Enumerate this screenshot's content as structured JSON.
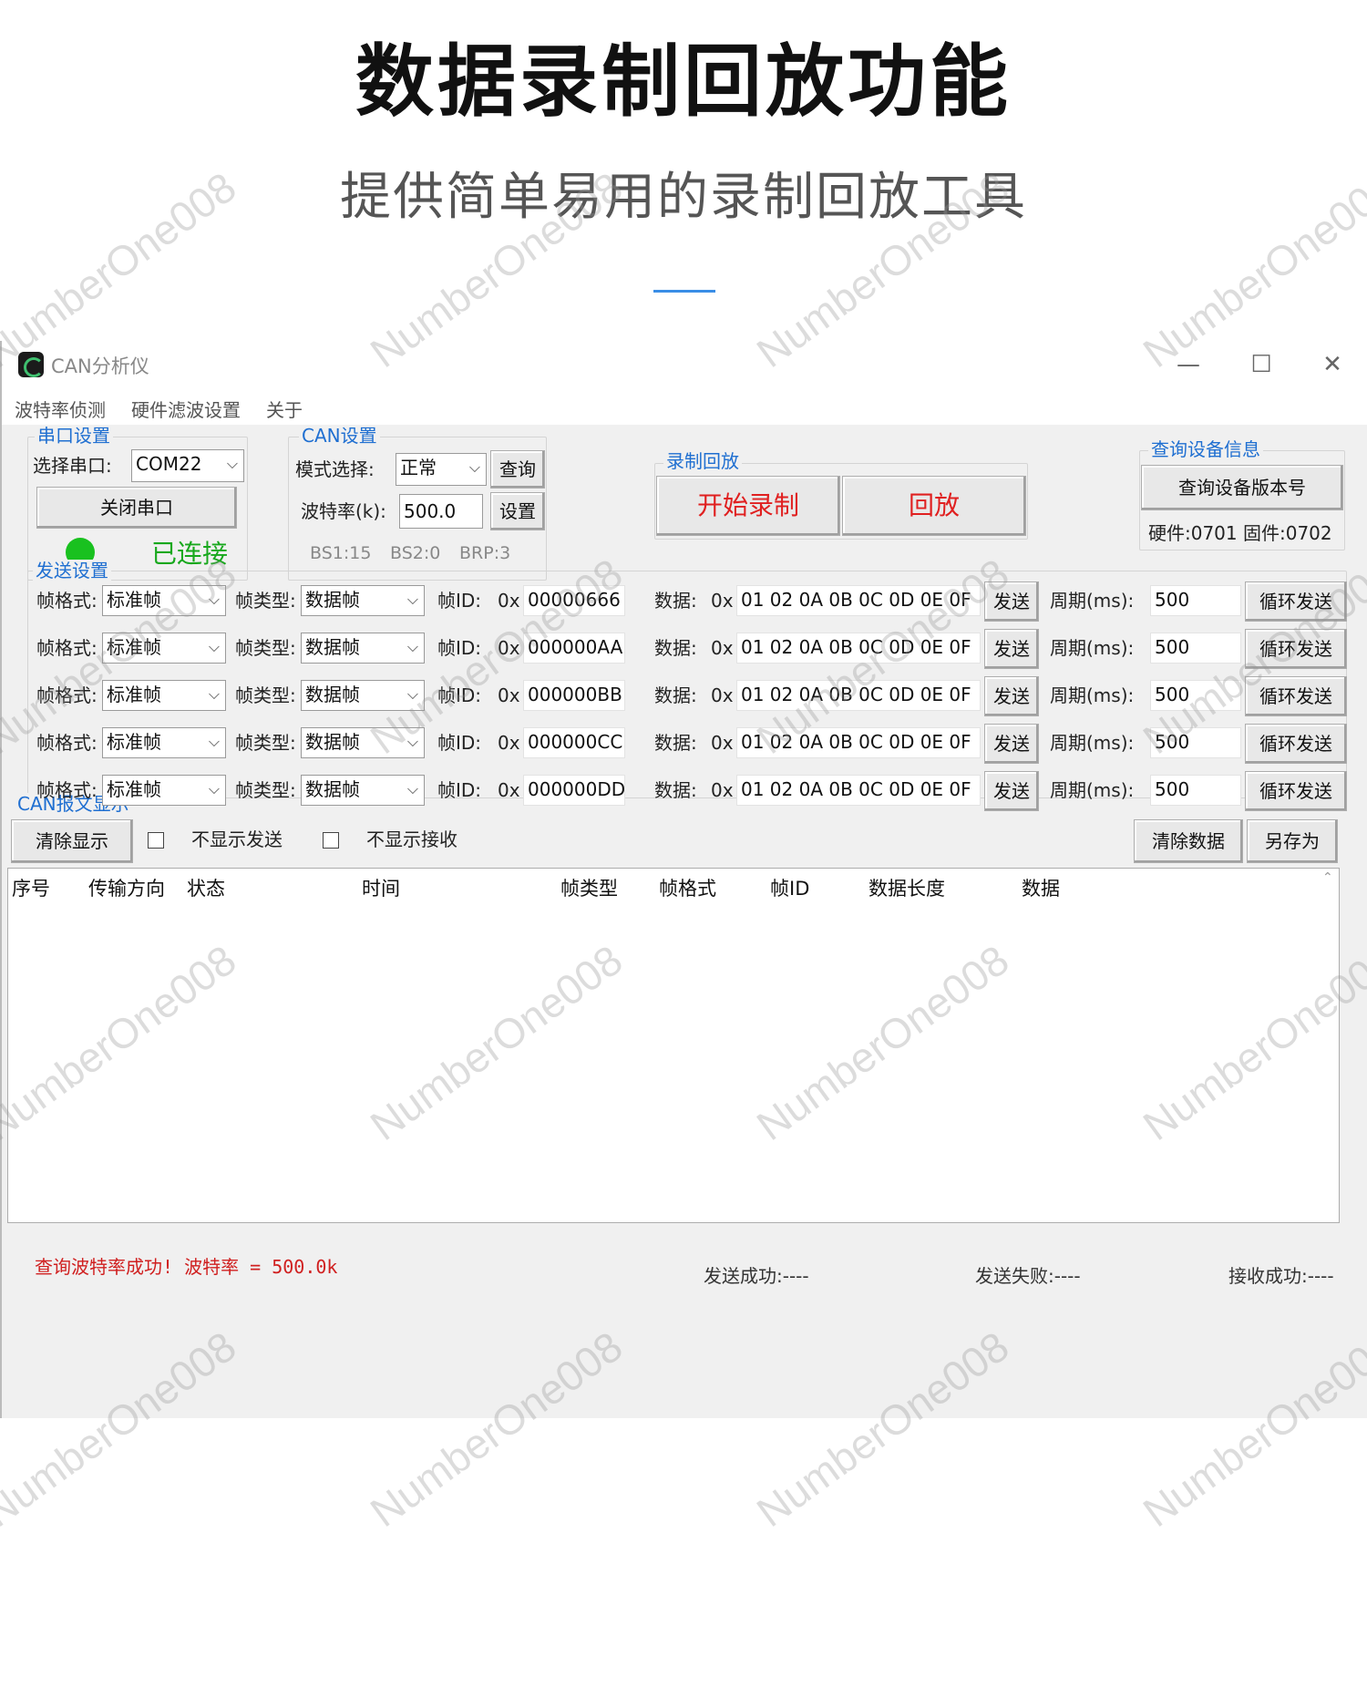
{
  "promo": {
    "title": "数据录制回放功能",
    "subtitle": "提供简单易用的录制回放工具"
  },
  "window": {
    "title": "CAN分析仪",
    "minimize": "—",
    "maximize": "☐",
    "close": "✕"
  },
  "menu": [
    "波特率侦测",
    "硬件滤波设置",
    "关于"
  ],
  "serial": {
    "group_title": "串口设置",
    "port_label": "选择串口:",
    "port_value": "COM22",
    "close_button": "关闭串口",
    "status": "已连接",
    "status_color": "#19c11f"
  },
  "can_settings": {
    "group_title": "CAN设置",
    "mode_label": "模式选择:",
    "mode_value": "正常",
    "query_button": "查询",
    "baud_label": "波特率(k):",
    "baud_value": "500.0",
    "set_button": "设置",
    "bs1": "BS1:15",
    "bs2": "BS2:0",
    "brp": "BRP:3"
  },
  "record": {
    "group_title": "录制回放",
    "start_button": "开始录制",
    "playback_button": "回放",
    "button_color": "#e02020"
  },
  "device_info": {
    "group_title": "查询设备信息",
    "query_button": "查询设备版本号",
    "version": "硬件:0701 固件:0702"
  },
  "send": {
    "group_title": "发送设置",
    "labels": {
      "format": "帧格式:",
      "type": "帧类型:",
      "id": "帧ID:",
      "hex": "0x",
      "data": "数据:",
      "send": "发送",
      "period": "周期(ms):",
      "cycle": "循环发送"
    },
    "rows": [
      {
        "format": "标准帧",
        "type": "数据帧",
        "id": "00000666",
        "data": "01 02 0A 0B 0C 0D 0E 0F",
        "period": "500"
      },
      {
        "format": "标准帧",
        "type": "数据帧",
        "id": "000000AA",
        "data": "01 02 0A 0B 0C 0D 0E 0F",
        "period": "500"
      },
      {
        "format": "标准帧",
        "type": "数据帧",
        "id": "000000BB",
        "data": "01 02 0A 0B 0C 0D 0E 0F",
        "period": "500"
      },
      {
        "format": "标准帧",
        "type": "数据帧",
        "id": "000000CC",
        "data": "01 02 0A 0B 0C 0D 0E 0F",
        "period": "500"
      },
      {
        "format": "标准帧",
        "type": "数据帧",
        "id": "000000DD",
        "data": "01 02 0A 0B 0C 0D 0E 0F",
        "period": "500"
      }
    ]
  },
  "display": {
    "group_title": "CAN报文显示",
    "clear_display": "清除显示",
    "hide_send": "不显示发送",
    "hide_receive": "不显示接收",
    "clear_data": "清除数据",
    "save_as": "另存为",
    "columns": [
      "序号",
      "传输方向",
      "状态",
      "时间",
      "帧类型",
      "帧格式",
      "帧ID",
      "数据长度",
      "数据"
    ]
  },
  "status_bar": {
    "message": "查询波特率成功! 波特率 = 500.0k",
    "send_ok": "发送成功:----",
    "send_fail": "发送失败:----",
    "recv_ok": "接收成功:----"
  },
  "watermark": "NumberOne008"
}
